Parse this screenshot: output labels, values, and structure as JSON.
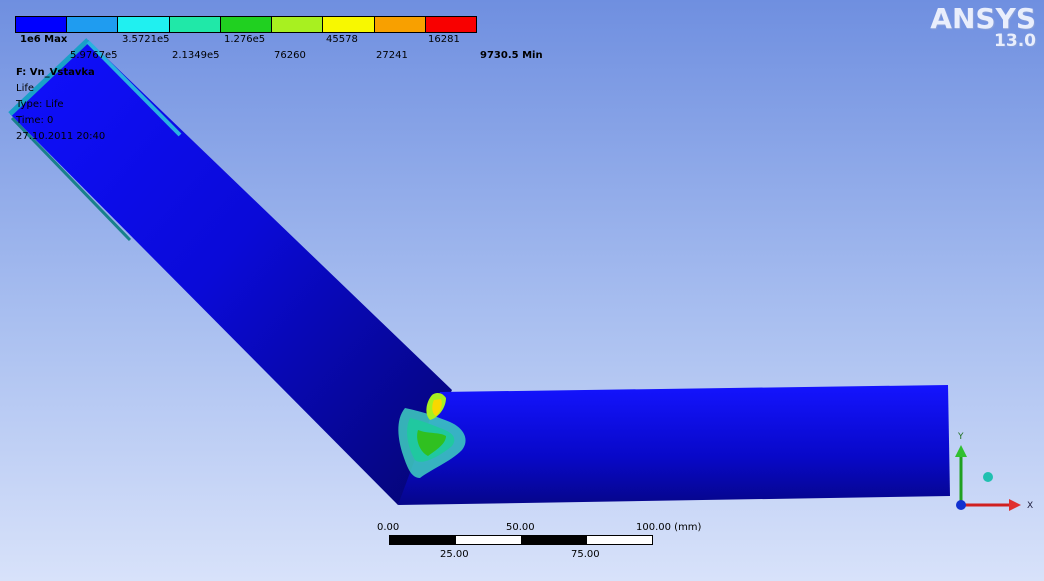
{
  "legend": {
    "colors": [
      "#0000ff",
      "#1f9cf0",
      "#20f0f0",
      "#20e8a8",
      "#20d020",
      "#a8f020",
      "#f8f800",
      "#f8a000",
      "#f80000"
    ],
    "top_labels": {
      "max": "1e6 Max",
      "l2": "3.5721e5",
      "l3": "1.276e5",
      "l4": "45578",
      "l5": "16281"
    },
    "bottom_labels": {
      "l1": "5.9767e5",
      "l2": "2.1349e5",
      "l3": "76260",
      "l4": "27241",
      "min": "9730.5 Min"
    }
  },
  "info": {
    "title": "F: Vn_Vstavka",
    "line1": "Life",
    "line2": "Type: Life",
    "line3": "Time: 0",
    "line4": "27.10.2011 20:40"
  },
  "logo": {
    "brand": "ANSYS",
    "version": "13.0"
  },
  "scale": {
    "top": {
      "t0": "0.00",
      "t1": "50.00",
      "t2": "100.00 (mm)"
    },
    "bottom": {
      "b1": "25.00",
      "b2": "75.00"
    }
  },
  "triad": {
    "y_label": "Y",
    "x_label": "X"
  }
}
